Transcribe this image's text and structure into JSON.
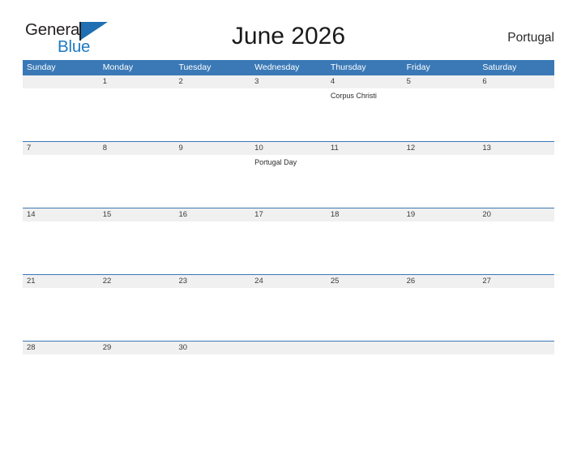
{
  "logo": {
    "word_one": "General",
    "word_two": "Blue",
    "flag_icon": "blue-flag-triangle-icon",
    "brand_blue": "#1f7ac0",
    "flag_blue": "#1f6fb2"
  },
  "header": {
    "title": "June 2026",
    "country": "Portugal"
  },
  "calendar": {
    "header_bg": "#3a79b6",
    "date_band_bg": "#f0f0f0",
    "weekdays": [
      "Sunday",
      "Monday",
      "Tuesday",
      "Wednesday",
      "Thursday",
      "Friday",
      "Saturday"
    ],
    "weeks": [
      {
        "days": [
          {
            "date": "",
            "event": ""
          },
          {
            "date": "1",
            "event": ""
          },
          {
            "date": "2",
            "event": ""
          },
          {
            "date": "3",
            "event": ""
          },
          {
            "date": "4",
            "event": "Corpus Christi"
          },
          {
            "date": "5",
            "event": ""
          },
          {
            "date": "6",
            "event": ""
          }
        ]
      },
      {
        "days": [
          {
            "date": "7",
            "event": ""
          },
          {
            "date": "8",
            "event": ""
          },
          {
            "date": "9",
            "event": ""
          },
          {
            "date": "10",
            "event": "Portugal Day"
          },
          {
            "date": "11",
            "event": ""
          },
          {
            "date": "12",
            "event": ""
          },
          {
            "date": "13",
            "event": ""
          }
        ]
      },
      {
        "days": [
          {
            "date": "14",
            "event": ""
          },
          {
            "date": "15",
            "event": ""
          },
          {
            "date": "16",
            "event": ""
          },
          {
            "date": "17",
            "event": ""
          },
          {
            "date": "18",
            "event": ""
          },
          {
            "date": "19",
            "event": ""
          },
          {
            "date": "20",
            "event": ""
          }
        ]
      },
      {
        "days": [
          {
            "date": "21",
            "event": ""
          },
          {
            "date": "22",
            "event": ""
          },
          {
            "date": "23",
            "event": ""
          },
          {
            "date": "24",
            "event": ""
          },
          {
            "date": "25",
            "event": ""
          },
          {
            "date": "26",
            "event": ""
          },
          {
            "date": "27",
            "event": ""
          }
        ]
      },
      {
        "days": [
          {
            "date": "28",
            "event": ""
          },
          {
            "date": "29",
            "event": ""
          },
          {
            "date": "30",
            "event": ""
          },
          {
            "date": "",
            "event": ""
          },
          {
            "date": "",
            "event": ""
          },
          {
            "date": "",
            "event": ""
          },
          {
            "date": "",
            "event": ""
          }
        ]
      }
    ]
  }
}
